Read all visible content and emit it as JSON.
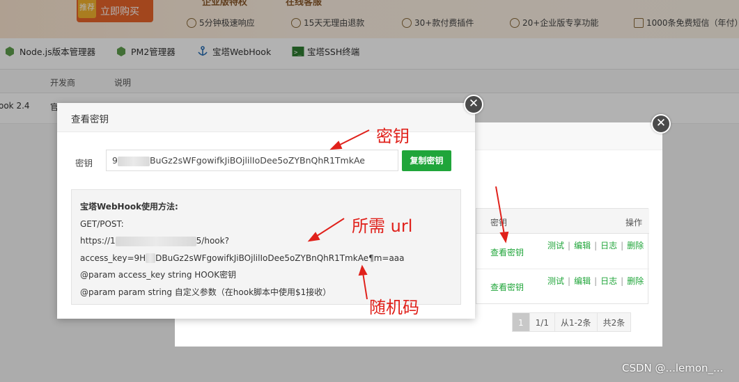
{
  "promo": {
    "tag": "推荐",
    "buy_label": "立即购买",
    "top_items": [
      "企业版特权",
      "在线客服"
    ],
    "features": [
      "5分钟极速响应",
      "15天无理由退款",
      "30+款付费插件",
      "20+企业版专享功能",
      "1000条免费短信（年付）"
    ]
  },
  "plugins": [
    {
      "label": "Node.js版本管理器",
      "icon": "node-icon"
    },
    {
      "label": "PM2管理器",
      "icon": "pm2-icon"
    },
    {
      "label": "宝塔WebHook",
      "icon": "anchor-icon"
    },
    {
      "label": "宝塔SSH终端",
      "icon": "terminal-icon"
    }
  ],
  "table": {
    "headers": [
      "开发商",
      "说明"
    ],
    "row": {
      "name": "ook 2.4",
      "dev": "官"
    }
  },
  "rear_dialog": {
    "columns": [
      "密钥",
      "操作"
    ],
    "rows": [
      {
        "view": "查看密钥",
        "actions": [
          "测试",
          "编辑",
          "日志",
          "删除"
        ]
      },
      {
        "view": "查看密钥",
        "actions": [
          "测试",
          "编辑",
          "日志",
          "删除"
        ]
      }
    ],
    "pager": [
      "1",
      "1/1",
      "从1-2条",
      "共2条"
    ]
  },
  "dialog": {
    "title": "查看密钥",
    "key_label": "密钥",
    "key_value_prefix": "9",
    "key_value_suffix": "BuGz2sWFgowifkJiBOjlilIoDee5oZYBnQhR1TmkAe",
    "copy_label": "复制密钥",
    "usage_title": "宝塔WebHook使用方法:",
    "method": "GET/POST:",
    "url_prefix": "https://1",
    "url_suffix": "5/hook?",
    "access_prefix": "access_key=9H",
    "access_middle": "DBuGz2sWFgowifkJiBOjlilIoDee5oZYBnQhR1TmkAe¶m=aaa",
    "param1": "@param access_key string HOOK密钥",
    "param2": "@param param string 自定义参数（在hook脚本中使用$1接收）"
  },
  "annotations": {
    "key": "密钥",
    "url": "所需 url",
    "random": "随机码",
    "color": "#e0211b"
  },
  "watermark": "CSDN @...lemon_..."
}
